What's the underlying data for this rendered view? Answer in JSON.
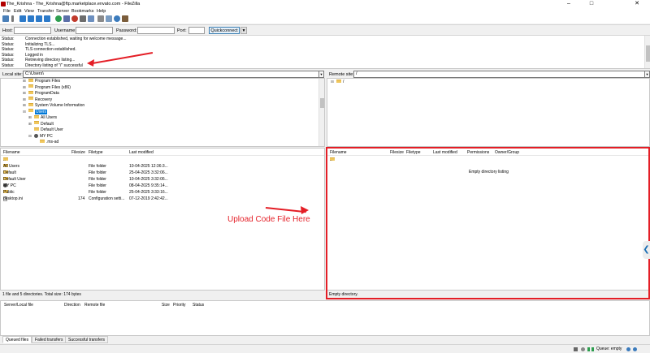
{
  "window": {
    "title": "The_Krishna - The_Krishna@ftp.marketplace.envato.com - FileZilla",
    "min_glyph": "–",
    "max_glyph": "□",
    "close_glyph": "✕"
  },
  "menu": [
    "File",
    "Edit",
    "View",
    "Transfer",
    "Server",
    "Bookmarks",
    "Help"
  ],
  "quickconnect": {
    "host_label": "Host:",
    "username_label": "Username:",
    "password_label": "Password:",
    "port_label": "Port:",
    "host_value": "",
    "username_value": "",
    "password_value": "",
    "port_value": "",
    "button_label": "Quickconnect",
    "dropdown_glyph": "▼"
  },
  "log": [
    {
      "k": "Status:",
      "v": "Connection established, waiting for welcome message..."
    },
    {
      "k": "Status:",
      "v": "Initializing TLS..."
    },
    {
      "k": "Status:",
      "v": "TLS connection established."
    },
    {
      "k": "Status:",
      "v": "Logged in"
    },
    {
      "k": "Status:",
      "v": "Retrieving directory listing..."
    },
    {
      "k": "Status:",
      "v": "Directory listing of \"/\" successful"
    }
  ],
  "local": {
    "site_label": "Local site:",
    "site_path": "C:\\Users\\",
    "tree": [
      {
        "label": "Program Files",
        "exp": "⊞"
      },
      {
        "label": "Program Files (x86)",
        "exp": "⊞"
      },
      {
        "label": "ProgramData",
        "exp": "⊞"
      },
      {
        "label": "Recovery",
        "exp": "⊞"
      },
      {
        "label": "System Volume Information",
        "exp": "⊞"
      },
      {
        "label": "Users",
        "exp": "⊟",
        "selected": true
      },
      {
        "label": "All Users",
        "exp": "⊞"
      },
      {
        "label": "Default",
        "exp": "⊞"
      },
      {
        "label": "Default User",
        "exp": ""
      },
      {
        "label": "MY PC",
        "exp": "⊟"
      },
      {
        "label": ".ms-ad",
        "exp": ""
      }
    ],
    "headers": {
      "filename": "Filename",
      "filesize": "Filesize",
      "filetype": "Filetype",
      "modified": "Last modified"
    },
    "files": [
      {
        "name": "..",
        "size": "",
        "type": "",
        "modified": ""
      },
      {
        "name": "All Users",
        "size": "",
        "type": "File folder",
        "modified": "10-04-2025 12:36:3..."
      },
      {
        "name": "Default",
        "size": "",
        "type": "File folder",
        "modified": "25-04-2025 3:32:06..."
      },
      {
        "name": "Default User",
        "size": "",
        "type": "File folder",
        "modified": "10-04-2025 3:32:06..."
      },
      {
        "name": "MY PC",
        "size": "",
        "type": "File folder",
        "modified": "08-04-2025 9:35:14..."
      },
      {
        "name": "Public",
        "size": "",
        "type": "File folder",
        "modified": "25-04-2025 3:33:16..."
      },
      {
        "name": "desktop.ini",
        "size": "174",
        "type": "Configuration setti...",
        "modified": "07-12-2019 2:42:42..."
      }
    ],
    "status": "1 file and 5 directories. Total size: 174 bytes"
  },
  "remote": {
    "site_label": "Remote site:",
    "site_path": "/",
    "tree_root": "/",
    "headers": {
      "filename": "Filename",
      "filesize": "Filesize",
      "filetype": "Filetype",
      "modified": "Last modified",
      "permissions": "Permissions",
      "owner": "Owner/Group"
    },
    "files": [
      {
        "name": ".."
      }
    ],
    "empty_message": "Empty directory listing",
    "status": "Empty directory."
  },
  "queue": {
    "headers": {
      "server": "Server/Local file",
      "direction": "Direction",
      "remote": "Remote file",
      "size": "Size",
      "priority": "Priority",
      "status": "Status"
    },
    "tabs": [
      "Queued files",
      "Failed transfers",
      "Successful transfers"
    ],
    "status": "Queue: empty"
  },
  "annotation": {
    "text": "Upload Code File Here",
    "color": "#e41e26"
  },
  "side_glyph": "❮"
}
